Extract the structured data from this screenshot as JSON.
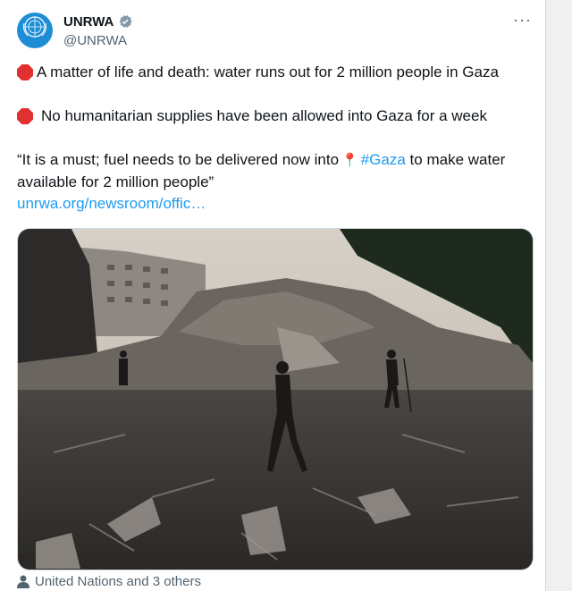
{
  "account": {
    "name": "UNRWA",
    "handle": "@UNRWA",
    "avatar_text": "unrwa",
    "avatar_text_ar": "الأونروا",
    "verified_icon": "verified-badge-icon"
  },
  "menu": {
    "more_label": "···"
  },
  "tweet": {
    "line1": "A matter of life and death: water runs out for 2 million people in Gaza",
    "line2": "No humanitarian supplies have been allowed into Gaza for a week",
    "quote_part1": "“It is a must; fuel needs to be delivered now into",
    "hashtag": "#Gaza",
    "quote_part2": "to make water",
    "quote_line2": "available for 2 million people”",
    "link": "unrwa.org/newsroom/offic…"
  },
  "colors": {
    "accent": "#1d9bf0",
    "stop_sign": "#e0302f",
    "brand": "#1d8ed6"
  },
  "footer": {
    "tagged_text": "United Nations and 3 others",
    "icon": "person-icon"
  }
}
